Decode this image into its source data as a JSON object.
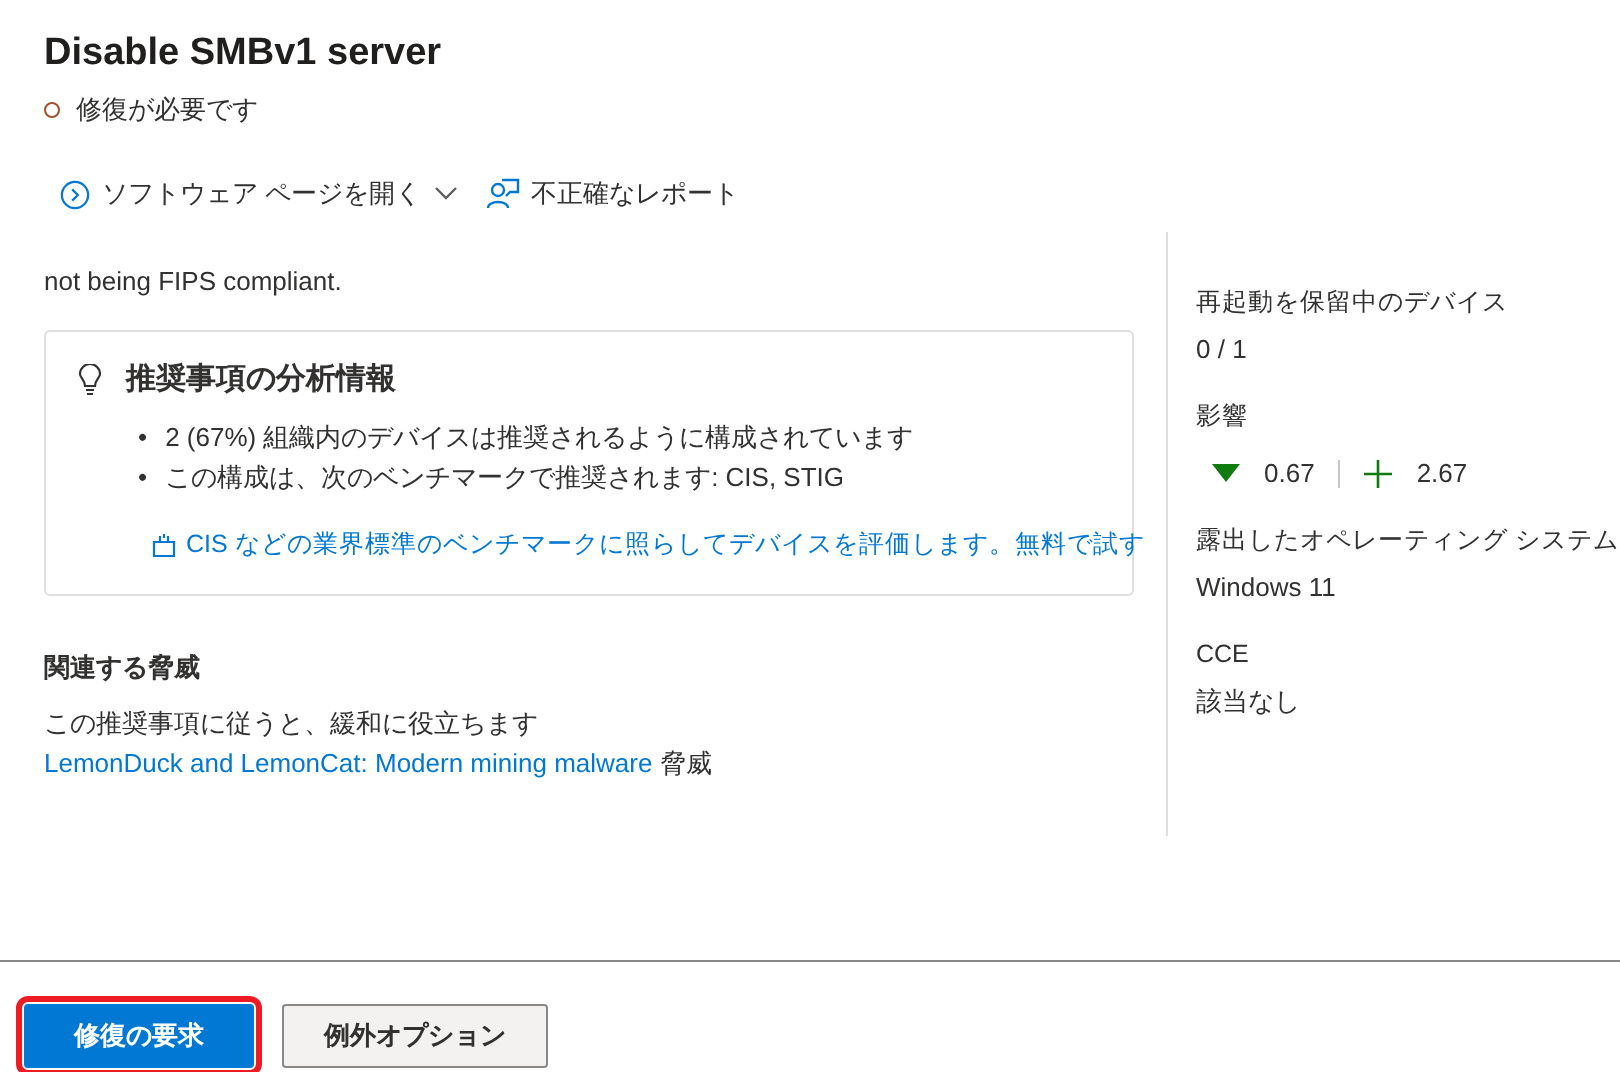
{
  "panel": {
    "title": "Disable SMBv1 server",
    "status": "修復が必要です"
  },
  "toolbar": [
    {
      "kind": "dropdown",
      "label": "ソフトウェア ページを開く"
    },
    {
      "kind": "report",
      "label": "不正確なレポート"
    }
  ],
  "description": {
    "lines": [
      "not being FIPS compliant."
    ]
  },
  "insights": {
    "title": "推奨事項の分析情報",
    "bullet_marker": "•",
    "bullets": [
      "2 (67%) 組織内のデバイスは推奨されるように構成されています",
      "この構成は、次のベンチマークで推奨されます: CIS, STIG"
    ],
    "link": "CIS などの業界標準のベンチマークに照らしてデバイスを評価します。無料で試す"
  },
  "related_threats": {
    "heading": "関連する脅威",
    "prefix": "この推奨事項に従うと、緩和に役立ちます",
    "link": "LemonDuck and LemonCat: Modern mining malware",
    "suffix": "脅威"
  },
  "details": [
    {
      "kind": "text",
      "label": "再起動を保留中のデバイス",
      "value": "0 / 1"
    },
    {
      "kind": "impact",
      "label": "影響",
      "exposure": "0.67",
      "score": "2.67"
    },
    {
      "kind": "text",
      "label": "露出したオペレーティング システム",
      "value": "Windows 11"
    },
    {
      "kind": "text",
      "label": "CCE",
      "value": "該当なし"
    }
  ],
  "buttons": [
    {
      "kind": "primary",
      "label": "修復の要求",
      "highlighted": true
    },
    {
      "kind": "default",
      "label": "例外オプション",
      "highlighted": false
    }
  ]
}
